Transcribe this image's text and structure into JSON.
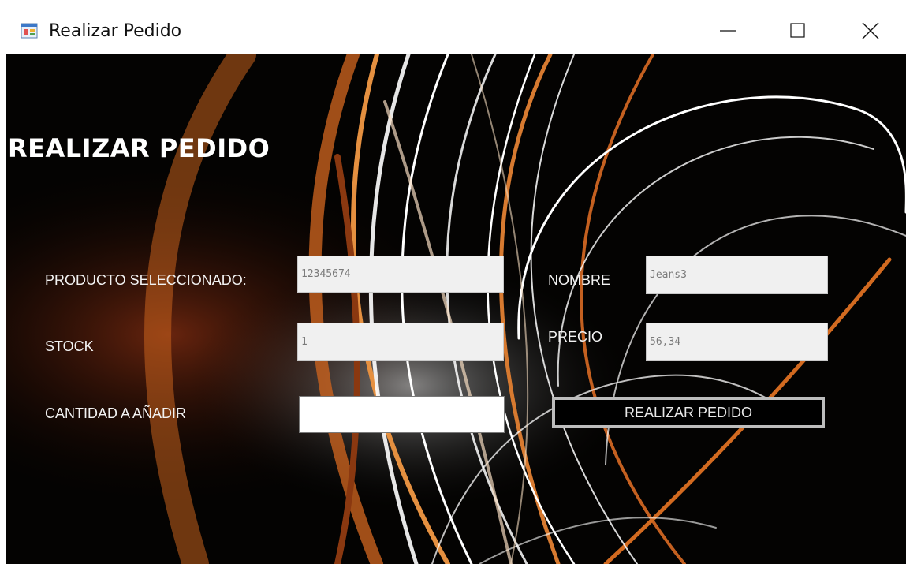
{
  "window": {
    "title": "Realizar Pedido",
    "controls": {
      "minimize": "minimize-icon",
      "maximize": "maximize-icon",
      "close": "close-icon"
    }
  },
  "form": {
    "heading": "REALIZAR PEDIDO",
    "producto_label": "PRODUCTO SELECCIONADO:",
    "producto_value": "12345674",
    "nombre_label": "NOMBRE",
    "nombre_value": "Jeans3",
    "stock_label": "STOCK",
    "stock_value": "1",
    "precio_label": "PRECIO",
    "precio_value": "56,34",
    "cantidad_label": "CANTIDAD A AÑADIR",
    "cantidad_value": "",
    "submit_label": "REALIZAR PEDIDO"
  },
  "colors": {
    "background": "#030303",
    "readonly_field": "#f0f0f0",
    "button_bg": "#000000",
    "button_border": "#bdbdbd",
    "light_streak_orange": "#d8782a",
    "light_streak_white": "#ffffff"
  }
}
